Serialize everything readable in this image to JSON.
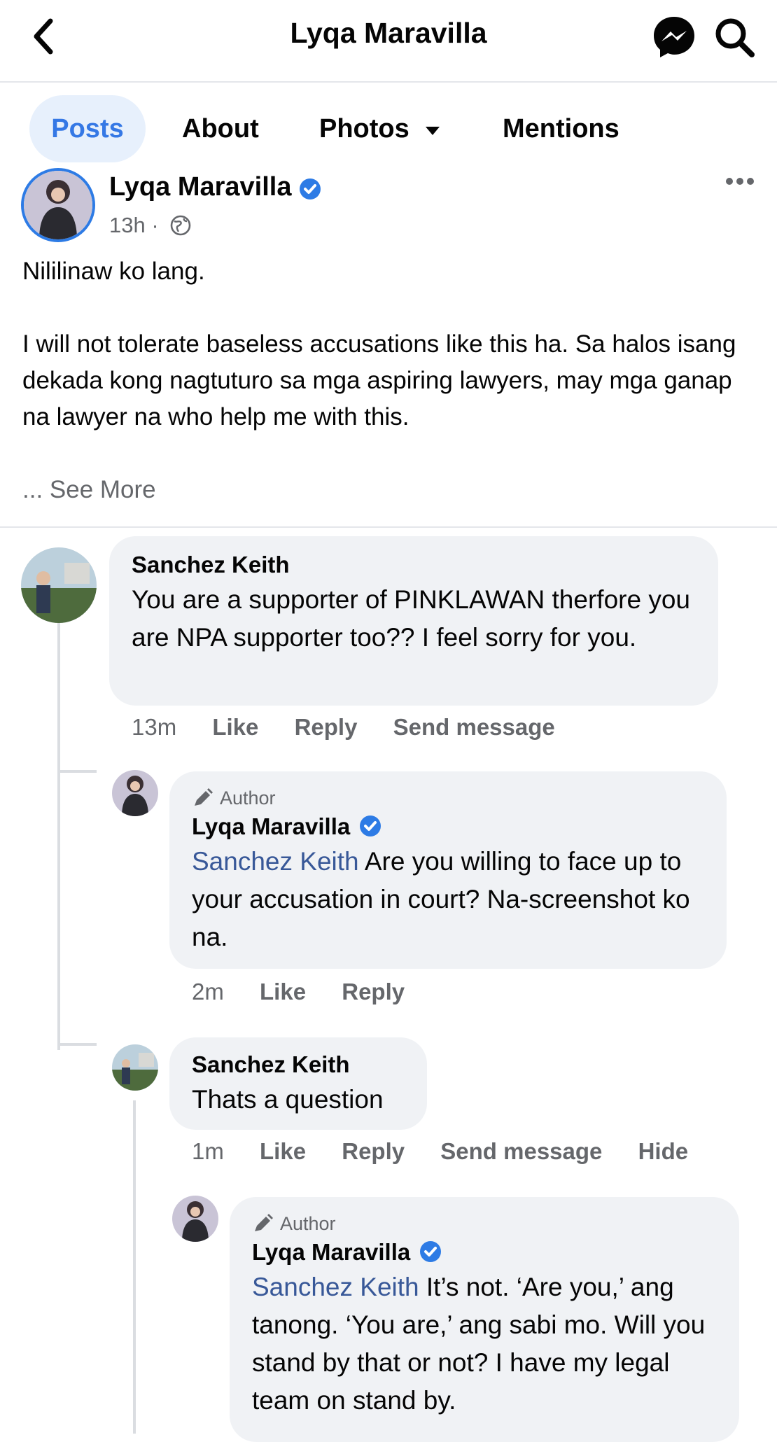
{
  "header": {
    "title": "Lyqa Maravilla"
  },
  "tabs": {
    "posts": "Posts",
    "about": "About",
    "photos": "Photos",
    "mentions": "Mentions"
  },
  "post": {
    "author": "Lyqa Maravilla",
    "time": "13h",
    "separator": "·",
    "paragraph1": "Nililinaw ko lang.",
    "paragraph2": "I will not tolerate baseless accusations like this ha. Sa halos isang dekada kong nagtuturo sa mga aspiring lawyers, may mga ganap na lawyer na who help me with this.",
    "see_more": "... See More"
  },
  "comments": [
    {
      "name": "Sanchez Keith",
      "text": "You are a supporter of PINKLAWAN therfore you are NPA supporter too??  I feel sorry for you.",
      "time": "13m",
      "like": "Like",
      "reply": "Reply",
      "send_message": "Send message"
    },
    {
      "author_tag": "Author",
      "name": "Lyqa Maravilla",
      "mention": "Sanchez Keith",
      "text": " Are you willing to face up to your accusation in court? Na-screenshot ko na.",
      "time": "2m",
      "like": "Like",
      "reply": "Reply"
    },
    {
      "name": "Sanchez Keith",
      "text": "Thats a question",
      "time": "1m",
      "like": "Like",
      "reply": "Reply",
      "send_message": "Send message",
      "hide": "Hide"
    },
    {
      "author_tag": "Author",
      "name": "Lyqa Maravilla",
      "mention": "Sanchez Keith",
      "text": " It’s not. ‘Are you,’ ang tanong. ‘You are,’ ang sabi mo. Will you stand by that or not? I have my legal team on stand by."
    }
  ],
  "colors": {
    "accent": "#3578e5",
    "verified": "#2d7be5",
    "mention": "#385898",
    "bubble": "#f0f2f5",
    "muted": "#65676b"
  },
  "icons": [
    "back-arrow-icon",
    "messenger-icon",
    "search-icon",
    "caret-down-icon",
    "verified-icon",
    "globe-icon",
    "more-icon",
    "pencil-icon"
  ]
}
